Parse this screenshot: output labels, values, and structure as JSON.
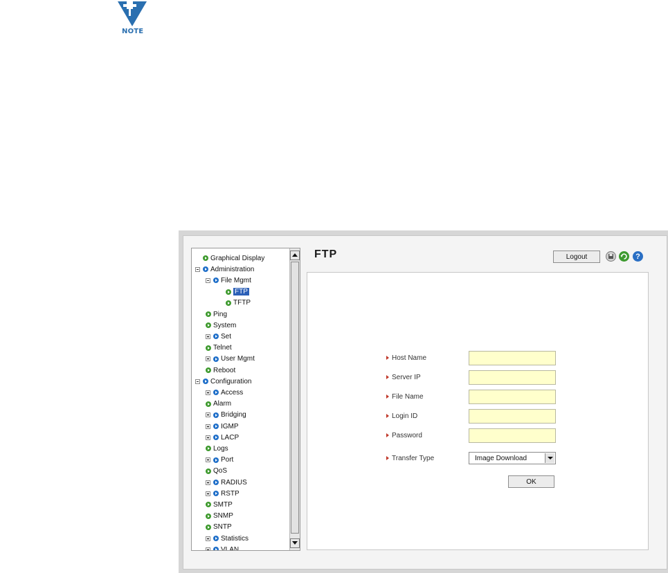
{
  "note": {
    "label": "NOTE"
  },
  "tree": {
    "items": [
      {
        "label": "Graphical Display",
        "level": 0,
        "toggle": "none",
        "dot": "green"
      },
      {
        "label": "Administration",
        "level": 0,
        "toggle": "minus",
        "dot": "blue"
      },
      {
        "label": "File Mgmt",
        "level": 1,
        "toggle": "minus",
        "dot": "blue"
      },
      {
        "label": "FTP",
        "level": 2,
        "toggle": "none",
        "dot": "green",
        "selected": true
      },
      {
        "label": "TFTP",
        "level": 2,
        "toggle": "none",
        "dot": "green"
      },
      {
        "label": "Ping",
        "level": 1,
        "toggle": "none",
        "dot": "green"
      },
      {
        "label": "System",
        "level": 1,
        "toggle": "none",
        "dot": "green"
      },
      {
        "label": "Set",
        "level": 1,
        "toggle": "plus",
        "dot": "blue"
      },
      {
        "label": "Telnet",
        "level": 1,
        "toggle": "none",
        "dot": "green"
      },
      {
        "label": "User Mgmt",
        "level": 1,
        "toggle": "plus",
        "dot": "blue"
      },
      {
        "label": "Reboot",
        "level": 1,
        "toggle": "none",
        "dot": "green"
      },
      {
        "label": "Configuration",
        "level": 0,
        "toggle": "minus",
        "dot": "blue"
      },
      {
        "label": "Access",
        "level": 1,
        "toggle": "plus",
        "dot": "blue"
      },
      {
        "label": "Alarm",
        "level": 1,
        "toggle": "none",
        "dot": "green"
      },
      {
        "label": "Bridging",
        "level": 1,
        "toggle": "plus",
        "dot": "blue"
      },
      {
        "label": "IGMP",
        "level": 1,
        "toggle": "plus",
        "dot": "blue"
      },
      {
        "label": "LACP",
        "level": 1,
        "toggle": "plus",
        "dot": "blue"
      },
      {
        "label": "Logs",
        "level": 1,
        "toggle": "none",
        "dot": "green"
      },
      {
        "label": "Port",
        "level": 1,
        "toggle": "plus",
        "dot": "blue"
      },
      {
        "label": "QoS",
        "level": 1,
        "toggle": "none",
        "dot": "green"
      },
      {
        "label": "RADIUS",
        "level": 1,
        "toggle": "plus",
        "dot": "blue"
      },
      {
        "label": "RSTP",
        "level": 1,
        "toggle": "plus",
        "dot": "blue"
      },
      {
        "label": "SMTP",
        "level": 1,
        "toggle": "none",
        "dot": "green"
      },
      {
        "label": "SNMP",
        "level": 1,
        "toggle": "none",
        "dot": "green"
      },
      {
        "label": "SNTP",
        "level": 1,
        "toggle": "none",
        "dot": "green"
      },
      {
        "label": "Statistics",
        "level": 1,
        "toggle": "plus",
        "dot": "blue"
      },
      {
        "label": "VLAN",
        "level": 1,
        "toggle": "plus",
        "dot": "blue"
      }
    ]
  },
  "header": {
    "title": "FTP",
    "logout_label": "Logout",
    "help_label": "?"
  },
  "form": {
    "fields": [
      {
        "label": "Host Name",
        "value": ""
      },
      {
        "label": "Server IP",
        "value": ""
      },
      {
        "label": "File Name",
        "value": ""
      },
      {
        "label": "Login ID",
        "value": ""
      },
      {
        "label": "Password",
        "value": ""
      }
    ],
    "transfer_type_label": "Transfer Type",
    "transfer_type_value": "Image Download",
    "ok_label": "OK"
  },
  "colors": {
    "selection": "#2b5fb7",
    "input_bg": "#ffffcc",
    "green_dot": "#3e9a2e",
    "blue_dot": "#1f6fc9",
    "label_marker": "#c0392b"
  }
}
